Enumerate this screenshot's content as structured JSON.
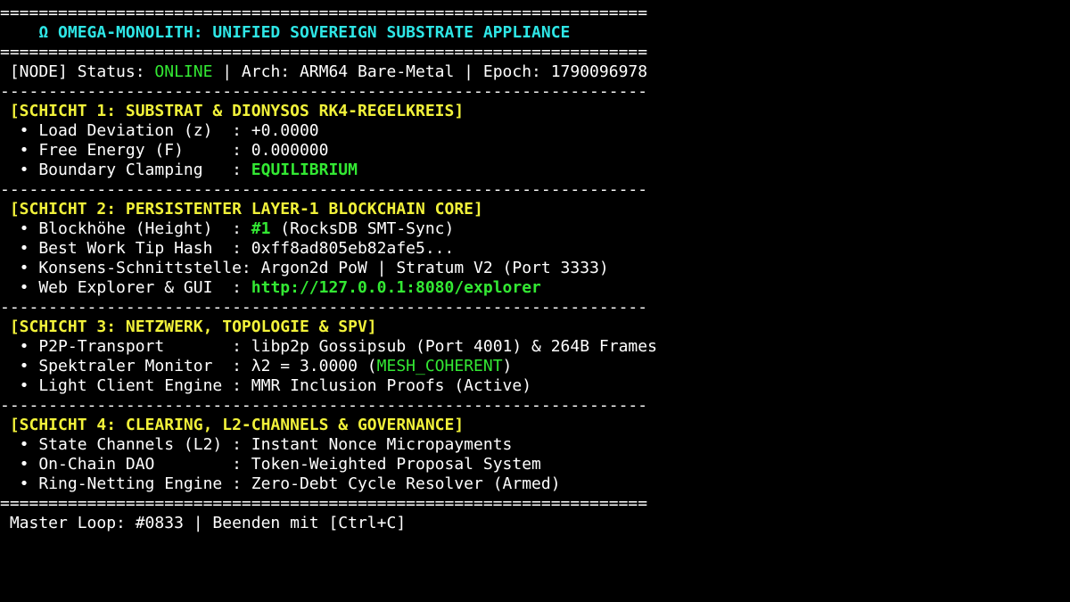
{
  "rules": {
    "double": "========================================================================================================",
    "single": "--------------------------------------------------------------------------------------------------------"
  },
  "header": {
    "title": "    Ω OMEGA-MONOLITH: UNIFIED SOVEREIGN SUBSTRATE APPLIANCE"
  },
  "status_line": {
    "prefix": " [NODE] Status: ",
    "status": "ONLINE",
    "suffix": " | Arch: ARM64 Bare-Metal | Epoch: 1790096978"
  },
  "layer1": {
    "heading": " [SCHICHT 1: SUBSTRAT & DIONYSOS RK4-REGELKREIS]",
    "rows": [
      {
        "label": "  • Load Deviation (z)  : ",
        "value": "+0.0000"
      },
      {
        "label": "  • Free Energy (F)     : ",
        "value": "0.000000"
      },
      {
        "label": "  • Boundary Clamping   : ",
        "value": "EQUILIBRIUM"
      }
    ]
  },
  "layer2": {
    "heading": " [SCHICHT 2: PERSISTENTER LAYER-1 BLOCKCHAIN CORE]",
    "height_label": "  • Blockhöhe (Height)  : ",
    "height_value": "#1",
    "height_suffix": " (RocksDB SMT-Sync)",
    "tip_label": "  • Best Work Tip Hash  : ",
    "tip_value": "0xff8ad805eb82afe5...",
    "consensus_label": "  • Konsens-Schnittstelle: ",
    "consensus_value": "Argon2d PoW | Stratum V2 (Port 3333)",
    "explorer_label": "  • Web Explorer & GUI  : ",
    "explorer_link": "http://127.0.0.1:8080/explorer"
  },
  "layer3": {
    "heading": " [SCHICHT 3: NETZWERK, TOPOLOGIE & SPV]",
    "p2p_label": "  • P2P-Transport       : ",
    "p2p_value": "libp2p Gossipsub (Port 4001) & 264B Frames",
    "spectral_label": "  • Spektraler Monitor  : ",
    "spectral_prefix": "λ2 = 3.0000 (",
    "spectral_state": "MESH_COHERENT",
    "spectral_suffix": ")",
    "light_label": "  • Light Client Engine : ",
    "light_value": "MMR Inclusion Proofs (Active)"
  },
  "layer4": {
    "heading": " [SCHICHT 4: CLEARING, L2-CHANNELS & GOVERNANCE]",
    "rows": [
      {
        "label": "  • State Channels (L2) : ",
        "value": "Instant Nonce Micropayments"
      },
      {
        "label": "  • On-Chain DAO        : ",
        "value": "Token-Weighted Proposal System"
      },
      {
        "label": "  • Ring-Netting Engine : ",
        "value": "Zero-Debt Cycle Resolver (Armed)"
      }
    ]
  },
  "footer": {
    "text": " Master Loop: #0833 | Beenden mit [Ctrl+C]"
  },
  "colors": {
    "background": "#000000",
    "title": "#2ee6e6",
    "heading": "#f2f23a",
    "ok": "#33e833",
    "text": "#ffffff"
  }
}
